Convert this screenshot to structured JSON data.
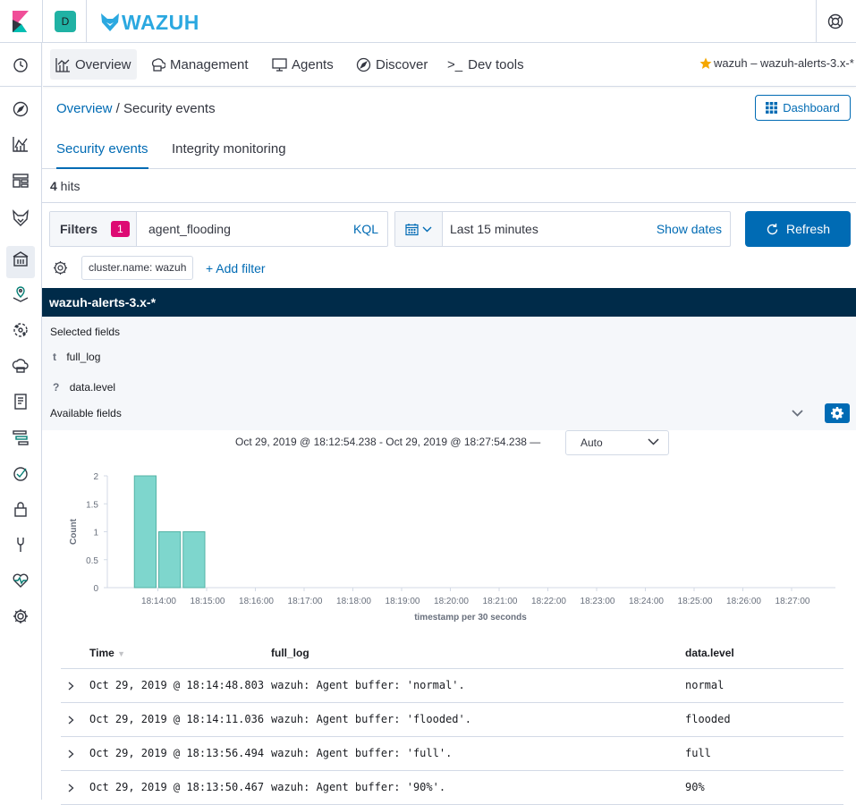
{
  "header": {
    "space_initial": "D",
    "logo_text": "WAZUH"
  },
  "menu": {
    "items": [
      {
        "label": "Overview"
      },
      {
        "label": "Management"
      },
      {
        "label": "Agents"
      },
      {
        "label": "Discover"
      },
      {
        "label": "Dev tools"
      }
    ],
    "pattern_label": "wazuh – wazuh-alerts-3.x-*"
  },
  "breadcrumb": {
    "root": "Overview",
    "separator": " / ",
    "current": "Security events"
  },
  "dashboard_button": "Dashboard",
  "tabs": [
    {
      "label": "Security events",
      "active": true
    },
    {
      "label": "Integrity monitoring",
      "active": false
    }
  ],
  "hits": {
    "count": "4",
    "suffix": " hits"
  },
  "query": {
    "filters_label": "Filters",
    "filters_count": "1",
    "text": "agent_flooding",
    "language": "KQL"
  },
  "date": {
    "range": "Last 15 minutes",
    "show_dates": "Show dates"
  },
  "refresh_label": "Refresh",
  "filter_pill": "cluster.name: wazuh",
  "add_filter": "+ Add filter",
  "fields": {
    "index_pattern": "wazuh-alerts-3.x-*",
    "selected_heading": "Selected fields",
    "selected": [
      {
        "type": "t",
        "name": "full_log"
      },
      {
        "type": "?",
        "name": "data.level"
      }
    ],
    "available_heading": "Available fields"
  },
  "histogram": {
    "time_range_text": "Oct 29, 2019 @ 18:12:54.238 - Oct 29, 2019 @ 18:27:54.238 —",
    "interval": "Auto"
  },
  "chart_data": {
    "type": "bar",
    "xlabel": "timestamp per 30 seconds",
    "ylabel": "Count",
    "ylim": [
      0,
      2
    ],
    "yticks": [
      "0",
      "0.5",
      "1",
      "1.5",
      "2"
    ],
    "xticks": [
      "18:14:00",
      "18:15:00",
      "18:16:00",
      "18:17:00",
      "18:18:00",
      "18:19:00",
      "18:20:00",
      "18:21:00",
      "18:22:00",
      "18:23:00",
      "18:24:00",
      "18:25:00",
      "18:26:00",
      "18:27:00"
    ],
    "bars": [
      {
        "x": "18:13:30",
        "value": 2
      },
      {
        "x": "18:14:00",
        "value": 1
      },
      {
        "x": "18:14:30",
        "value": 1
      }
    ],
    "bar_color": "#7ed6cd",
    "bar_border": "#54b3a6"
  },
  "table": {
    "columns": [
      "Time",
      "full_log",
      "data.level"
    ],
    "rows": [
      {
        "time": "Oct 29, 2019 @ 18:14:48.803",
        "full_log": "wazuh: Agent buffer: 'normal'.",
        "level": "normal"
      },
      {
        "time": "Oct 29, 2019 @ 18:14:11.036",
        "full_log": "wazuh: Agent buffer: 'flooded'.",
        "level": "flooded"
      },
      {
        "time": "Oct 29, 2019 @ 18:13:56.494",
        "full_log": "wazuh: Agent buffer: 'full'.",
        "level": "full"
      },
      {
        "time": "Oct 29, 2019 @ 18:13:50.467",
        "full_log": "wazuh: Agent buffer: '90%'.",
        "level": "90%"
      }
    ]
  }
}
